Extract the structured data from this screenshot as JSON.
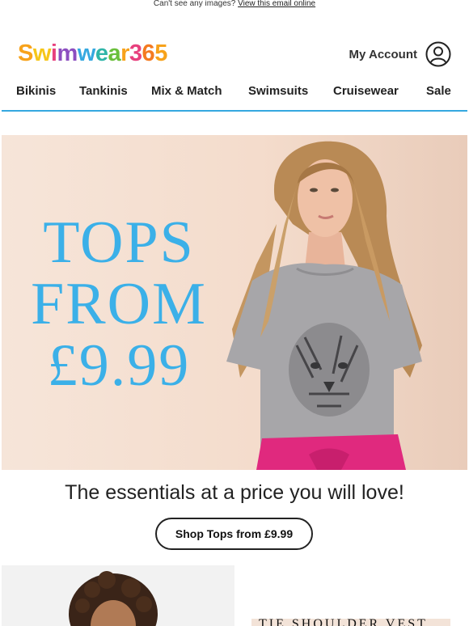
{
  "preheader": {
    "text": "Can't see any images?",
    "link": "View this email online"
  },
  "brand": {
    "letters": [
      "S",
      "w",
      "i",
      "m",
      "w",
      "e",
      "a",
      "r",
      "3",
      "6",
      "5"
    ],
    "colors": [
      "#f7a21b",
      "#f6c619",
      "#e7407d",
      "#8c4ec0",
      "#35a8e0",
      "#2fb5a8",
      "#6abf3b",
      "#f7a21b",
      "#e7407d",
      "#f47a20",
      "#f7a21b"
    ]
  },
  "account": {
    "label": "My Account",
    "icon": "user-icon"
  },
  "nav": {
    "items": [
      "Bikinis",
      "Tankinis",
      "Mix & Match",
      "Swimsuits",
      "Cruisewear",
      "Sale"
    ],
    "rule_color": "#35a8e0"
  },
  "hero": {
    "lines": [
      "TOPS",
      "FROM",
      "£9.99"
    ],
    "text_color": "#3bb0e8"
  },
  "tagline": "The essentials at a price you will love!",
  "cta": {
    "label": "Shop Tops from £9.99"
  },
  "promo": {
    "title": "TIE SHOULDER VEST"
  }
}
